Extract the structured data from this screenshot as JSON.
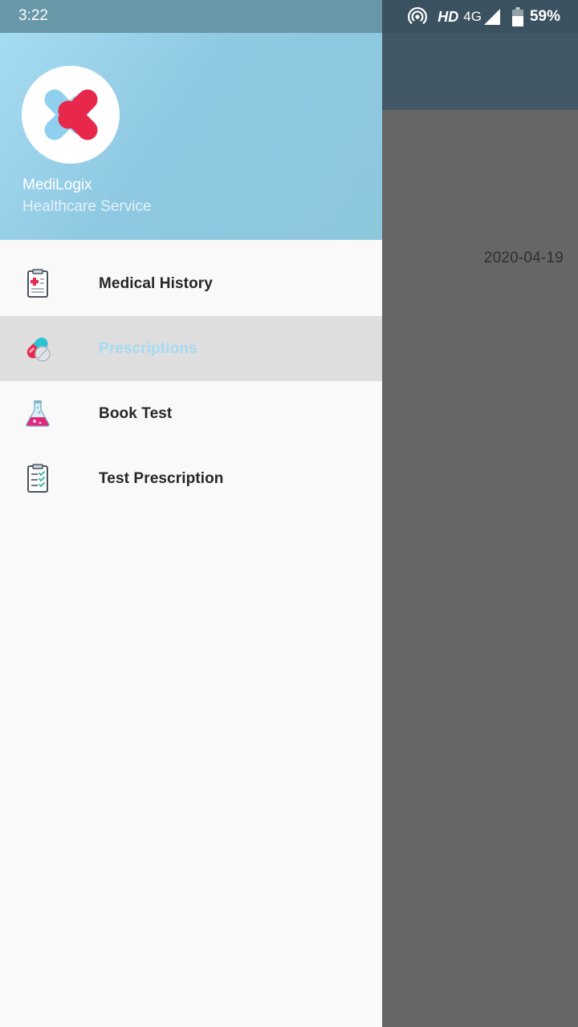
{
  "status_bar": {
    "time": "3:22",
    "hd": "HD",
    "network": "4G",
    "battery": "59%",
    "icons": [
      "hotspot-icon",
      "signal-icon",
      "battery-icon"
    ]
  },
  "background": {
    "date": "2020-04-19"
  },
  "drawer": {
    "header": {
      "app_name": "MediLogix",
      "subtitle": "Healthcare Service",
      "logo": "medilogix-logo"
    },
    "items": [
      {
        "label": "Medical History",
        "icon": "clipboard-medical-icon",
        "active": false
      },
      {
        "label": "Prescriptions",
        "icon": "pill-capsule-icon",
        "active": true
      },
      {
        "label": "Book Test",
        "icon": "flask-icon",
        "active": false
      },
      {
        "label": "Test Prescription",
        "icon": "checklist-clipboard-icon",
        "active": false
      }
    ]
  },
  "colors": {
    "header_gradient_start": "#a5dcf3",
    "header_gradient_end": "#8dc7dc",
    "active_item_bg": "#dedede",
    "active_item_text": "#a5dbf3",
    "logo_red": "#e8284a",
    "logo_blue": "#8fd0ef"
  }
}
